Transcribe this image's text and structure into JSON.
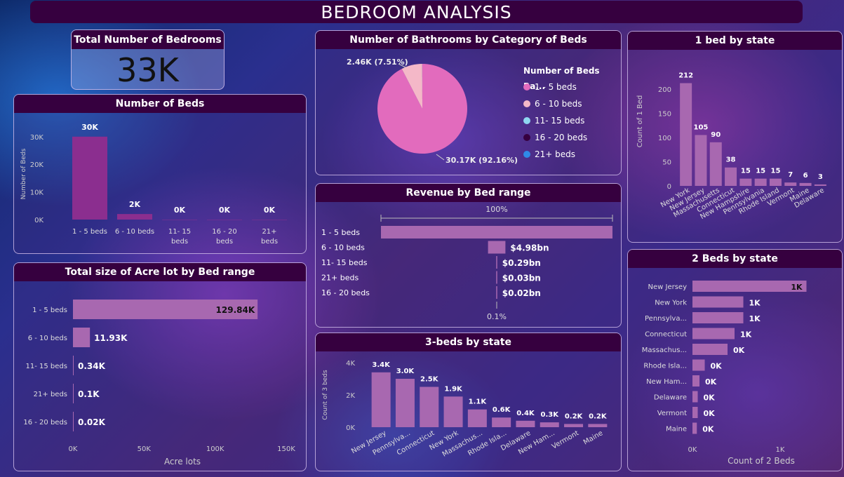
{
  "header": {
    "title": "BEDROOM ANALYSIS"
  },
  "kpi": {
    "title": "Total Number of Bedrooms",
    "value": "33K"
  },
  "colors": {
    "bar": "#a868b0",
    "bar_dark": "#8b2e8f",
    "pie_main": "#e26bbd",
    "pie_second": "#f4b8c8",
    "title_bg": "#36003f"
  },
  "beds": {
    "title": "Number of Beds",
    "chart_data": {
      "type": "bar",
      "categories": [
        "1 - 5 beds",
        "6 - 10 beds",
        "11- 15 beds",
        "16 - 20 beds",
        "21+ beds"
      ],
      "values": [
        30000,
        2000,
        0,
        0,
        0
      ],
      "data_labels": [
        "30K",
        "2K",
        "0K",
        "0K",
        "0K"
      ],
      "ylabel": "Number of Beds",
      "yticks": [
        "0K",
        "10K",
        "20K",
        "30K"
      ],
      "ylim": [
        0,
        33000
      ]
    }
  },
  "acre": {
    "title": "Total size of Acre lot by Bed range",
    "chart_data": {
      "type": "bar",
      "orientation": "horizontal",
      "categories": [
        "1 - 5 beds",
        "6 - 10 beds",
        "11- 15 beds",
        "21+ beds",
        "16 - 20 beds"
      ],
      "values": [
        129840,
        11930,
        340,
        100,
        20
      ],
      "data_labels": [
        "129.84K",
        "11.93K",
        "0.34K",
        "0.1K",
        "0.02K"
      ],
      "xlabel": "Acre lots",
      "xticks": [
        "0K",
        "50K",
        "100K",
        "150K"
      ],
      "xlim": [
        0,
        150000
      ]
    }
  },
  "bathrooms": {
    "title": "Number of Bathrooms by Category of Beds",
    "chart_data": {
      "type": "pie",
      "categories": [
        "1 - 5 beds",
        "6 - 10 beds",
        "11- 15 beds",
        "16 - 20 beds",
        "21+ beds"
      ],
      "values": [
        30170,
        2460,
        5,
        3,
        2
      ],
      "labels": {
        "main": "30.17K (92.16%)",
        "second": "2.46K (7.51%)"
      },
      "legend_title": "Number of Beds Ra...",
      "legend_colors": [
        "#e26bbd",
        "#f4b8c8",
        "#8fd6f0",
        "#36003f",
        "#2f8ae8"
      ]
    }
  },
  "revenue": {
    "title": "Revenue by Bed range",
    "chart_data": {
      "type": "bar",
      "orientation": "horizontal",
      "subtype": "funnel",
      "categories": [
        "1 - 5 beds",
        "6 - 10 beds",
        "11- 15 beds",
        "21+ beds",
        "16 - 20 beds"
      ],
      "values": [
        66.3,
        4.98,
        0.29,
        0.03,
        0.02
      ],
      "data_labels": [
        "",
        "$4.98bn",
        "$0.29bn",
        "$0.03bn",
        "$0.02bn"
      ],
      "top_label": "100%",
      "bottom_label": "0.1%"
    }
  },
  "beds3": {
    "title": "3-beds by state",
    "chart_data": {
      "type": "bar",
      "categories": [
        "New Jersey",
        "Pennsylva...",
        "Connecticut",
        "New York",
        "Massachus...",
        "Rhode Isla...",
        "Delaware",
        "New Ham...",
        "Vermont",
        "Maine"
      ],
      "values": [
        3400,
        3000,
        2500,
        1900,
        1100,
        600,
        400,
        300,
        200,
        200
      ],
      "data_labels": [
        "3.4K",
        "3.0K",
        "2.5K",
        "1.9K",
        "1.1K",
        "0.6K",
        "0.4K",
        "0.3K",
        "0.2K",
        "0.2K"
      ],
      "ylabel": "Count of 3 beds",
      "yticks": [
        "0K",
        "2K",
        "4K"
      ],
      "ylim": [
        0,
        4000
      ]
    }
  },
  "bed1": {
    "title": "1 bed by state",
    "chart_data": {
      "type": "bar",
      "categories": [
        "New York",
        "New Jersey",
        "Massachusetts",
        "Connecticut",
        "New Hampshire",
        "Pennsylvania",
        "Rhode Island",
        "Vermont",
        "Maine",
        "Delaware"
      ],
      "values": [
        212,
        105,
        90,
        38,
        15,
        15,
        15,
        7,
        6,
        3
      ],
      "data_labels": [
        "212",
        "105",
        "90",
        "38",
        "15",
        "15",
        "15",
        "7",
        "6",
        "3"
      ],
      "ylabel": "Count of 1 Bed",
      "yticks": [
        "0",
        "50",
        "100",
        "150",
        "200"
      ],
      "ylim": [
        0,
        220
      ]
    }
  },
  "beds2": {
    "title": "2 Beds by state",
    "chart_data": {
      "type": "bar",
      "orientation": "horizontal",
      "categories": [
        "New Jersey",
        "New York",
        "Pennsylva...",
        "Connecticut",
        "Massachus...",
        "Rhode Isla...",
        "New Ham...",
        "Delaware",
        "Vermont",
        "Maine"
      ],
      "values": [
        1300,
        580,
        580,
        480,
        400,
        140,
        80,
        60,
        60,
        50
      ],
      "data_labels": [
        "1K",
        "1K",
        "1K",
        "1K",
        "0K",
        "0K",
        "0K",
        "0K",
        "0K",
        "0K"
      ],
      "xlabel": "Count of 2 Beds",
      "xticks": [
        "0K",
        "1K"
      ],
      "xlim": [
        0,
        1000
      ]
    }
  }
}
